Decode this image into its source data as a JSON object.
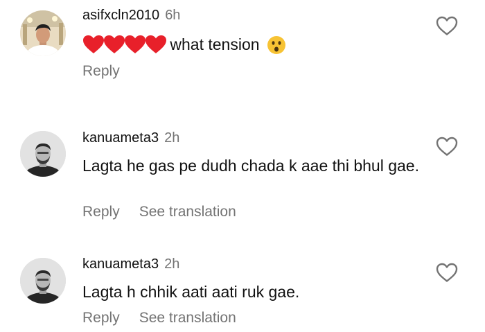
{
  "comments": [
    {
      "username": "asifxcln2010",
      "time": "6h",
      "text": "what tension",
      "reply_label": "Reply",
      "heart_count": 4,
      "hearts_emoji": "heart-emoji",
      "trailing_emoji": "astonished-face-emoji"
    },
    {
      "username": "kanuameta3",
      "time": "2h",
      "text": "Lagta he gas pe dudh chada k aae thi bhul gae.",
      "reply_label": "Reply",
      "translate_label": "See translation"
    },
    {
      "username": "kanuameta3",
      "time": "2h",
      "text": "Lagta h chhik aati aati ruk gae.",
      "reply_label": "Reply",
      "translate_label": "See translation"
    }
  ],
  "icons": {
    "like": "heart-outline-icon"
  },
  "colors": {
    "text": "#111111",
    "muted": "#737373",
    "heart_emoji": "#e8202a",
    "emoji_face": "#f7c334",
    "background": "#ffffff"
  }
}
